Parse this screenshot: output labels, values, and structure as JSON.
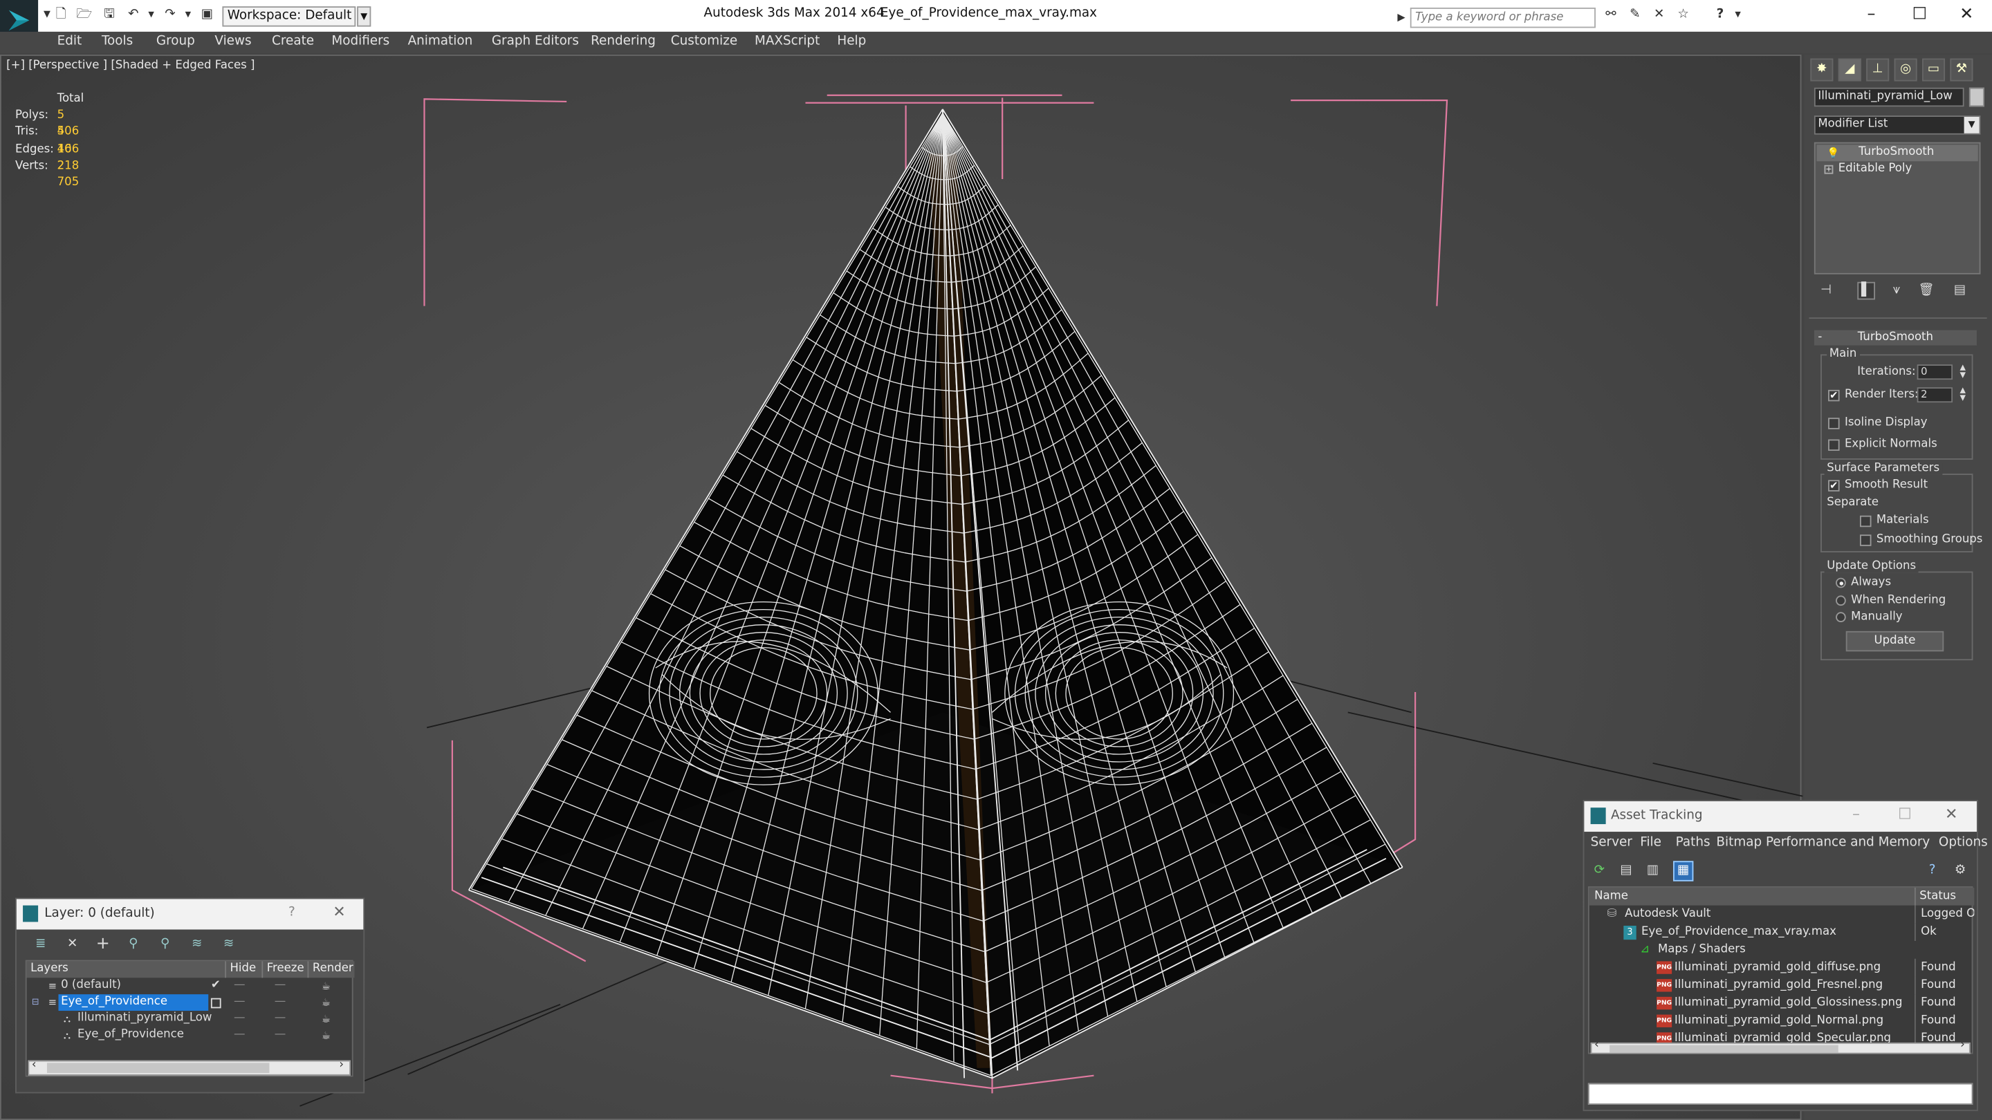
{
  "app": {
    "title": "Autodesk 3ds Max  2014 x64",
    "file_name": "Eye_of_Providence_max_vray.max",
    "workspace": "Workspace: Default",
    "search_placeholder": "Type a keyword or phrase"
  },
  "menu": [
    "Edit",
    "Tools",
    "Group",
    "Views",
    "Create",
    "Modifiers",
    "Animation",
    "Graph Editors",
    "Rendering",
    "Customize",
    "MAXScript",
    "Help"
  ],
  "viewport": {
    "label": "[+] [Perspective ] [Shaded + Edged Faces ]",
    "stats": {
      "total_label": "Total",
      "rows": [
        {
          "label": "Polys:",
          "value": "5 406"
        },
        {
          "label": "Tris:",
          "value": "5 406"
        },
        {
          "label": "Edges:",
          "value": "16 218"
        },
        {
          "label": "Verts:",
          "value": "2 705"
        }
      ]
    }
  },
  "command_panel": {
    "object_name": "Illuminati_pyramid_Low",
    "modifier_list": "Modifier List",
    "stack": [
      {
        "name": "TurboSmooth",
        "selected": true
      },
      {
        "name": "Editable Poly",
        "selected": false
      }
    ],
    "turbosmooth": {
      "title": "TurboSmooth",
      "main_label": "Main",
      "iterations_label": "Iterations:",
      "iterations_value": "0",
      "render_iters_label": "Render Iters:",
      "render_iters_value": "2",
      "render_iters_checked": true,
      "isoline_label": "Isoline Display",
      "explicit_label": "Explicit Normals",
      "surface_label": "Surface Parameters",
      "smooth_label": "Smooth Result",
      "separate_label": "Separate",
      "materials_label": "Materials",
      "smoothing_label": "Smoothing Groups",
      "update_options_label": "Update Options",
      "always_label": "Always",
      "when_rendering_label": "When Rendering",
      "manually_label": "Manually",
      "update_button": "Update"
    }
  },
  "layer_window": {
    "title": "Layer: 0 (default)",
    "help": "?",
    "columns": [
      "Layers",
      "Hide",
      "Freeze",
      "Render"
    ],
    "rows": [
      {
        "name": "0 (default)",
        "indent": 0,
        "selected": false
      },
      {
        "name": "Eye_of_Providence",
        "indent": 0,
        "selected": true
      },
      {
        "name": "Illuminati_pyramid_Low",
        "indent": 1,
        "selected": false
      },
      {
        "name": "Eye_of_Providence",
        "indent": 1,
        "selected": false
      }
    ]
  },
  "asset_tracking": {
    "title": "Asset Tracking",
    "menu": [
      "Server",
      "File",
      "Paths",
      "Bitmap Performance and Memory",
      "Options"
    ],
    "columns": [
      "Name",
      "Status"
    ],
    "rows": [
      {
        "name": "Autodesk Vault",
        "status": "Logged O",
        "indent": 0,
        "icon": "vault"
      },
      {
        "name": "Eye_of_Providence_max_vray.max",
        "status": "Ok",
        "indent": 1,
        "icon": "max"
      },
      {
        "name": "Maps / Shaders",
        "status": "",
        "indent": 2,
        "icon": "folder"
      },
      {
        "name": "Illuminati_pyramid_gold_diffuse.png",
        "status": "Found",
        "indent": 3,
        "icon": "png"
      },
      {
        "name": "Illuminati_pyramid_gold_Fresnel.png",
        "status": "Found",
        "indent": 3,
        "icon": "png"
      },
      {
        "name": "Illuminati_pyramid_gold_Glossiness.png",
        "status": "Found",
        "indent": 3,
        "icon": "png"
      },
      {
        "name": "Illuminati_pyramid_gold_Normal.png",
        "status": "Found",
        "indent": 3,
        "icon": "png"
      },
      {
        "name": "Illuminati_pyramid_gold_Specular.png",
        "status": "Found",
        "indent": 3,
        "icon": "png"
      }
    ]
  }
}
